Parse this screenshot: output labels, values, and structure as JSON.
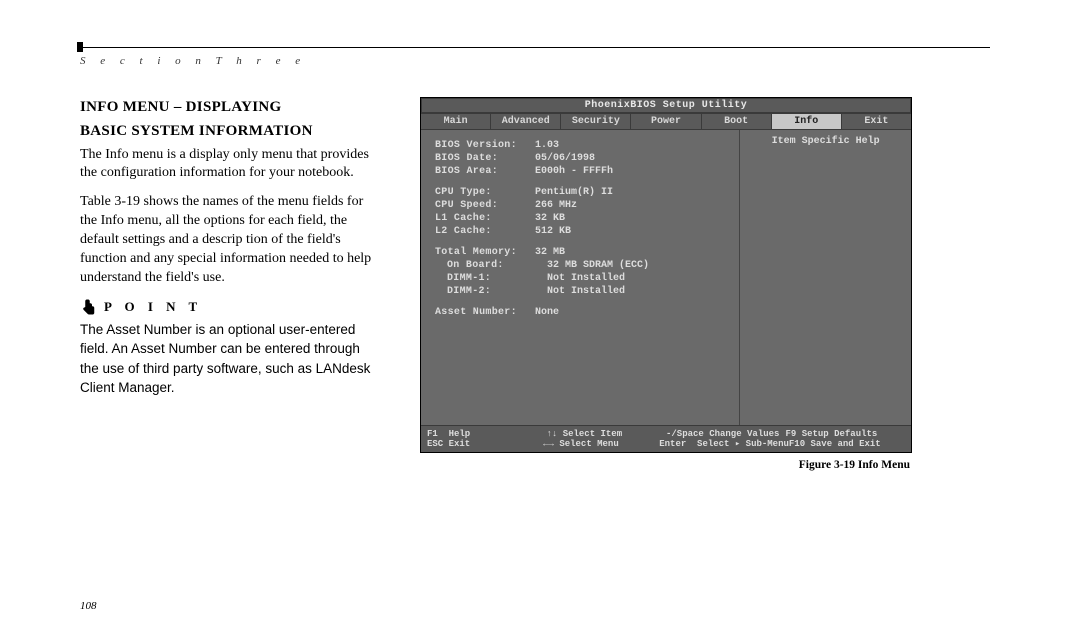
{
  "section_label": "S e c t i o n   T h r e e",
  "heading_l1": "INFO MENU  – DISPLAYING",
  "heading_l2": "BASIC SYSTEM INFORMATION",
  "para1": "The Info menu is a display only menu that provides the configuration information for your notebook.",
  "para2": "Table 3-19 shows the names of the menu fields for the Info menu, all the options for each field, the default settings and a descrip tion of the field's function and any special information needed to help understand the field's use.",
  "point_label": "P O I N T",
  "point_body": "The Asset Number is an optional user-entered field. An Asset Number can be entered through the use of third party software, such as LANdesk Client Manager.",
  "bios": {
    "title": "PhoenixBIOS Setup Utility",
    "tabs": [
      "Main",
      "Advanced",
      "Security",
      "Power",
      "Boot",
      "Info",
      "Exit"
    ],
    "selected_tab": "Info",
    "help_title": "Item Specific Help",
    "rows": [
      {
        "k": "BIOS Version:",
        "v": "1.03"
      },
      {
        "k": "BIOS Date:",
        "v": "05/06/1998"
      },
      {
        "k": "BIOS Area:",
        "v": "E000h - FFFFh"
      },
      {
        "gap": true
      },
      {
        "k": "CPU Type:",
        "v": "Pentium(R) II"
      },
      {
        "k": "CPU Speed:",
        "v": "266 MHz"
      },
      {
        "k": "L1 Cache:",
        "v": "32 KB"
      },
      {
        "k": "L2 Cache:",
        "v": "512 KB"
      },
      {
        "gap": true
      },
      {
        "k": "Total Memory:",
        "v": "32 MB"
      },
      {
        "k": "On Board:",
        "v": "32 MB SDRAM (ECC)",
        "ind": true
      },
      {
        "k": "DIMM-1:",
        "v": "Not Installed",
        "ind": true
      },
      {
        "k": "DIMM-2:",
        "v": "Not Installed",
        "ind": true
      },
      {
        "gap": true
      },
      {
        "k": "Asset Number:",
        "v": "None"
      }
    ],
    "footer": [
      [
        {
          "t": "F1  Help"
        },
        {
          "t": "↑↓ Select Item"
        },
        {
          "t": "-/Space Change Values"
        },
        {
          "t": "F9 Setup Defaults"
        }
      ],
      [
        {
          "t": "ESC Exit"
        },
        {
          "t": "←→ Select Menu"
        },
        {
          "t": "Enter  Select ▸ Sub-Menu"
        },
        {
          "t": "F10 Save and Exit"
        }
      ]
    ]
  },
  "caption": "Figure 3-19 Info Menu",
  "page_number": "108"
}
